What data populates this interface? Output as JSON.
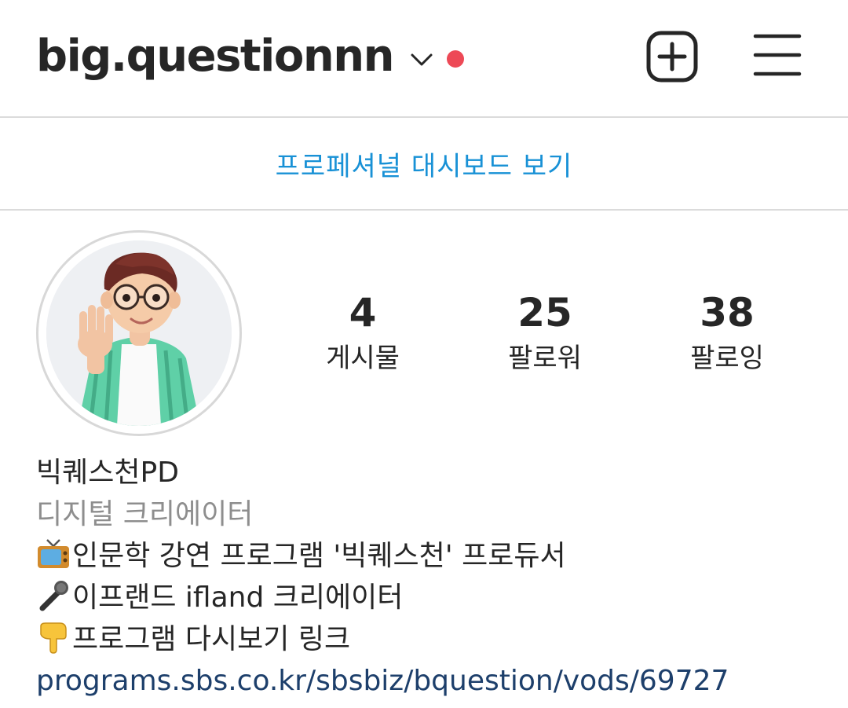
{
  "header": {
    "username": "big.questionnn",
    "chevron_icon": "chevron-down-icon",
    "notification_color": "#ed4956",
    "add_icon": "plus-square-icon",
    "menu_icon": "hamburger-menu-icon"
  },
  "dashboard": {
    "link_label": "프로페셔널 대시보드 보기",
    "color": "#1891d6"
  },
  "stats": [
    {
      "value": "4",
      "label": "게시물"
    },
    {
      "value": "25",
      "label": "팔로워"
    },
    {
      "value": "38",
      "label": "팔로잉"
    }
  ],
  "bio": {
    "name": "빅퀘스천PD",
    "category": "디지털 크리에이터",
    "lines": [
      {
        "icon": "tv-icon",
        "text": "인문학 강연 프로그램 '빅퀘스천' 프로듀서"
      },
      {
        "icon": "microphone-icon",
        "text": "이프랜드 ifland 크리에이터"
      },
      {
        "icon": "pointing-down-hand-icon",
        "text": "프로그램 다시보기 링크"
      }
    ],
    "link": "programs.sbs.co.kr/sbsbiz/bquestion/vods/69727",
    "link_color": "#1d3f6b"
  }
}
